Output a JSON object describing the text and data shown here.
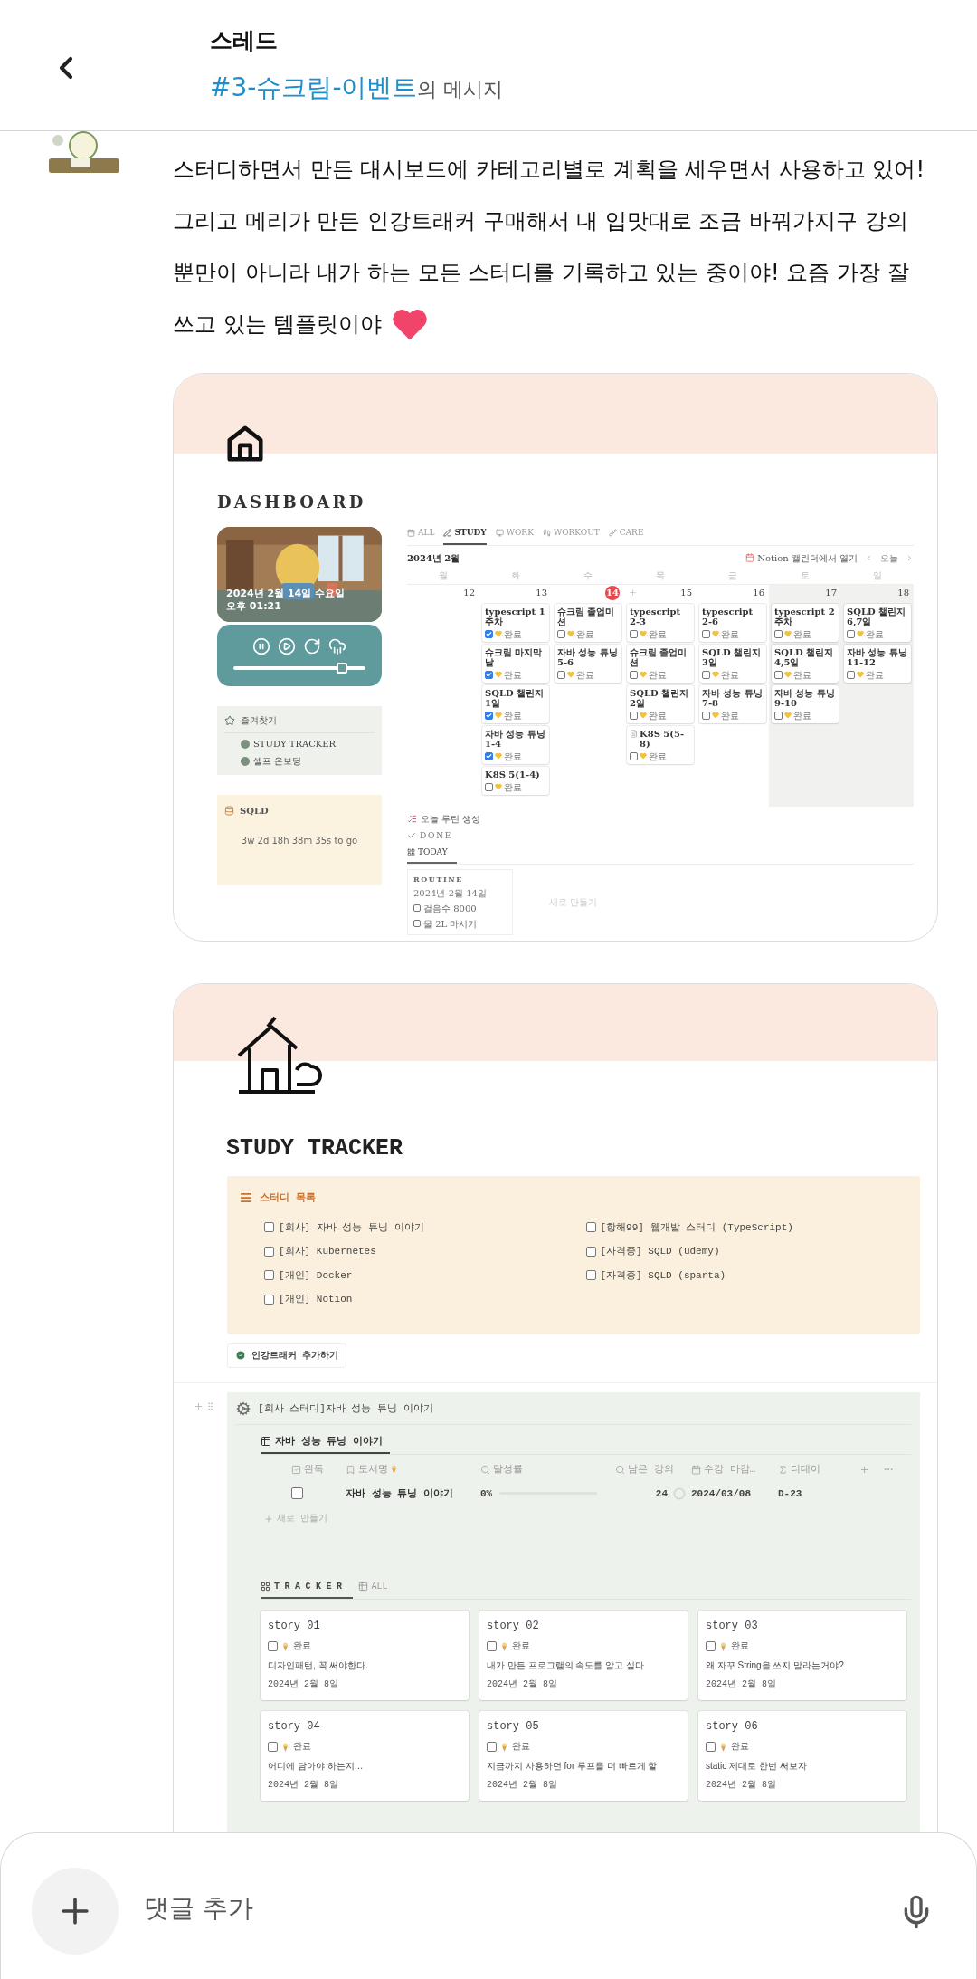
{
  "header": {
    "title": "스레드",
    "channel": "#3-슈크림-이벤트",
    "subtitle": "의 메시지"
  },
  "message": {
    "lines": [
      "스터디하면서 만든 대시보드에 카테고리별로 계획을 세우면서 사용하고 있어!",
      "그리고 메리가 만든 인강트래커 구매해서 내 입맛대로 조금 바꿔가지구 강의",
      "뿐만이 아니라 내가 하는 모든 스터디를 기록하고 있는 중이야! 요즘 가장 잘",
      "쓰고 있는 템플릿이야"
    ]
  },
  "dashboard": {
    "title": "DASHBOARD",
    "widget": {
      "date": "2024년 2월 14일 수요일",
      "time": "오후 01:21"
    },
    "player": {
      "level": 0.85
    },
    "favorites": {
      "title": "즐겨찾기",
      "items": [
        "STUDY TRACKER",
        "셀프 온보딩"
      ]
    },
    "countdown": {
      "title": "SQLD",
      "text": "3w 2d 18h 38m 35s to go"
    },
    "tabs": [
      {
        "label": "ALL",
        "selected": false
      },
      {
        "label": "STUDY",
        "selected": true
      },
      {
        "label": "WORK",
        "selected": false
      },
      {
        "label": "WORKOUT",
        "selected": false
      },
      {
        "label": "CARE",
        "selected": false
      }
    ],
    "calendar": {
      "month": "2024년 2월",
      "open_button": "Notion 캘린더에서 열기",
      "today_button": "오늘",
      "weekdays": [
        "월",
        "화",
        "수",
        "목",
        "금",
        "토",
        "일"
      ],
      "days": [
        {
          "date": "12",
          "today": false,
          "add": false,
          "weekend": false
        },
        {
          "date": "13",
          "today": false,
          "add": false,
          "weekend": false,
          "events": [
            {
              "title": "typescript 1주차",
              "checked": true,
              "doc": false,
              "status": "완료"
            },
            {
              "title": "슈크림 마지막날",
              "checked": true,
              "doc": false,
              "status": "완료"
            },
            {
              "title": "SQLD 챌린지 1일",
              "checked": true,
              "doc": false,
              "status": "완료"
            },
            {
              "title": "자바 성능 튜닝 1-4",
              "checked": true,
              "doc": false,
              "status": "완료"
            },
            {
              "title": "K8S 5(1-4)",
              "checked": false,
              "doc": false,
              "status": "완료"
            }
          ]
        },
        {
          "date": "14",
          "today": true,
          "add": false,
          "weekend": false,
          "events": [
            {
              "title": "슈크림 졸업미션",
              "checked": false,
              "doc": false,
              "status": "완료"
            },
            {
              "title": "자바 성능 튜닝 5-6",
              "checked": false,
              "doc": false,
              "status": "완료"
            }
          ]
        },
        {
          "date": "15",
          "today": false,
          "add": true,
          "weekend": false,
          "events": [
            {
              "title": "typescript 2-3",
              "checked": false,
              "doc": false,
              "status": "완료"
            },
            {
              "title": "슈크림 졸업미션",
              "checked": false,
              "doc": false,
              "status": "완료"
            },
            {
              "title": "SQLD 챌린지 2일",
              "checked": false,
              "doc": false,
              "status": "완료"
            },
            {
              "title": "K8S 5(5-8)",
              "checked": false,
              "doc": true,
              "status": "완료"
            }
          ]
        },
        {
          "date": "16",
          "today": false,
          "add": false,
          "weekend": false,
          "events": [
            {
              "title": "typescript 2-6",
              "checked": false,
              "doc": false,
              "status": "완료"
            },
            {
              "title": "SQLD 챌린지 3일",
              "checked": false,
              "doc": false,
              "status": "완료"
            },
            {
              "title": "자바 성능 튜닝 7-8",
              "checked": false,
              "doc": false,
              "status": "완료"
            }
          ]
        },
        {
          "date": "17",
          "today": false,
          "add": false,
          "weekend": true,
          "events": [
            {
              "title": "typescript 2주차",
              "checked": false,
              "doc": false,
              "status": "완료"
            },
            {
              "title": "SQLD 챌린지 4,5일",
              "checked": false,
              "doc": false,
              "status": "완료"
            },
            {
              "title": "자바 성능 튜닝 9-10",
              "checked": false,
              "doc": false,
              "status": "완료"
            }
          ]
        },
        {
          "date": "18",
          "today": false,
          "add": false,
          "weekend": true,
          "events": [
            {
              "title": "SQLD 챌린지 6,7일",
              "checked": false,
              "doc": false,
              "status": "완료"
            },
            {
              "title": "자바 성능 튜닝 11-12",
              "checked": false,
              "doc": false,
              "status": "완료"
            }
          ]
        }
      ]
    },
    "routine_button": "오늘 루틴 생성",
    "done_label": "DONE",
    "view_tabs": [
      {
        "label": "TODAY",
        "selected": true
      }
    ],
    "routine": {
      "title": "ROUTINE",
      "date": "2024년 2월 14일",
      "items": [
        {
          "label": "걸음수 8000",
          "checked": false
        },
        {
          "label": "물 2L 마시기",
          "checked": false
        }
      ]
    },
    "new_button": "새로 만들기"
  },
  "tracker": {
    "title": "STUDY TRACKER",
    "study_list": {
      "title": "스터디 목록",
      "items": [
        {
          "label": "[회사] 자바 성능 튜닝 이야기",
          "checked": false
        },
        {
          "label": "[회사] Kubernetes",
          "checked": false
        },
        {
          "label": "[개인] Docker",
          "checked": false
        },
        {
          "label": "[개인] Notion",
          "checked": false
        },
        {
          "label": "[항해99] 웹개발 스터디 (TypeScript)",
          "checked": false
        },
        {
          "label": "[자격증] SQLD (udemy)",
          "checked": false
        },
        {
          "label": "[자격증] SQLD (sparta)",
          "checked": false
        }
      ]
    },
    "add_button": "인강트래커 추가하기",
    "section": {
      "title": "[회사 스터디]자바 성능 튜닝 이야기",
      "table_tabs": [
        {
          "label": "자바 성능 튜닝 이야기",
          "selected": true
        }
      ],
      "columns": [
        "완독",
        "도서명",
        "달성률",
        "남은 강의",
        "수강 마감…",
        "디데이"
      ],
      "rows": [
        {
          "checked": false,
          "title": "자바 성능 튜닝 이야기",
          "progress": "0%",
          "level": 0,
          "remaining": "24",
          "deadline": "2024/03/08",
          "dday": "D-23"
        }
      ],
      "new_button": "새로 만들기",
      "view_tabs": [
        {
          "label": "TRACKER",
          "selected": true
        },
        {
          "label": "ALL",
          "selected": false
        }
      ],
      "cards": [
        {
          "title": "story 01",
          "checked": false,
          "status": "완료",
          "text": "디자인패턴, 꼭 써야한다.",
          "date": "2024년 2월 8일"
        },
        {
          "title": "story 02",
          "checked": false,
          "status": "완료",
          "text": "내가 만든 프로그램의 속도를 알고 싶다",
          "date": "2024년 2월 8일"
        },
        {
          "title": "story 03",
          "checked": false,
          "status": "완료",
          "text": "왜 자꾸 String을 쓰지 말라는거야?",
          "date": "2024년 2월 8일"
        },
        {
          "title": "story 04",
          "checked": false,
          "status": "완료",
          "text": "어디에 담아야 하는지…",
          "date": "2024년 2월 8일"
        },
        {
          "title": "story 05",
          "checked": false,
          "status": "완료",
          "text": "지금까지 사용하던 for 루프를 더 빠르게 할",
          "date": "2024년 2월 8일"
        },
        {
          "title": "story 06",
          "checked": false,
          "status": "완료",
          "text": "static 제대로 한번 써보자",
          "date": "2024년 2월 8일"
        }
      ]
    }
  },
  "composer": {
    "placeholder": "댓글 추가"
  }
}
